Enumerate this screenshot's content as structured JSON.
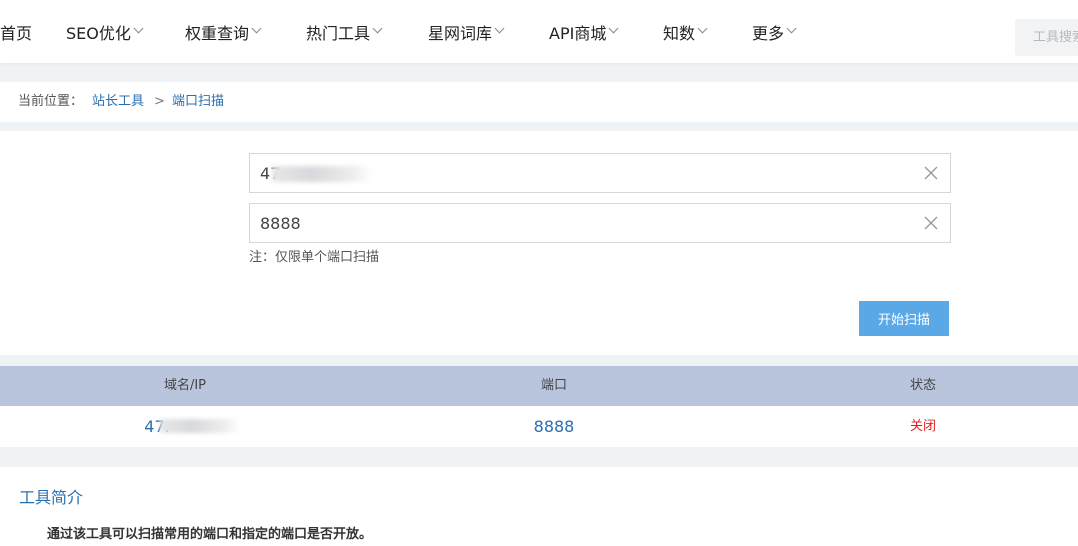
{
  "nav": {
    "items": [
      {
        "label": "首页",
        "has_dropdown": false
      },
      {
        "label": "SEO优化",
        "has_dropdown": true
      },
      {
        "label": "权重查询",
        "has_dropdown": true
      },
      {
        "label": "热门工具",
        "has_dropdown": true
      },
      {
        "label": "星网词库",
        "has_dropdown": true
      },
      {
        "label": "API商城",
        "has_dropdown": true
      },
      {
        "label": "知数",
        "has_dropdown": true
      },
      {
        "label": "更多",
        "has_dropdown": true
      }
    ],
    "search_placeholder": "工具搜索"
  },
  "breadcrumb": {
    "prefix": "当前位置：",
    "items": [
      "站长工具",
      "端口扫描"
    ],
    "separator": ">"
  },
  "form": {
    "host_value": "47.",
    "port_value": "8888",
    "note": "注：仅限单个端口扫描",
    "submit_label": "开始扫描"
  },
  "results": {
    "headers": [
      "域名/IP",
      "端口",
      "状态"
    ],
    "rows": [
      {
        "host": "47.",
        "port": "8888",
        "status": "关闭"
      }
    ]
  },
  "intro": {
    "title": "工具简介",
    "text": "通过该工具可以扫描常用的端口和指定的端口是否开放。"
  },
  "colors": {
    "link": "#2a6fb0",
    "button": "#5aa9e6",
    "table_header": "#b9c5dd",
    "status_closed": "#e02020"
  }
}
